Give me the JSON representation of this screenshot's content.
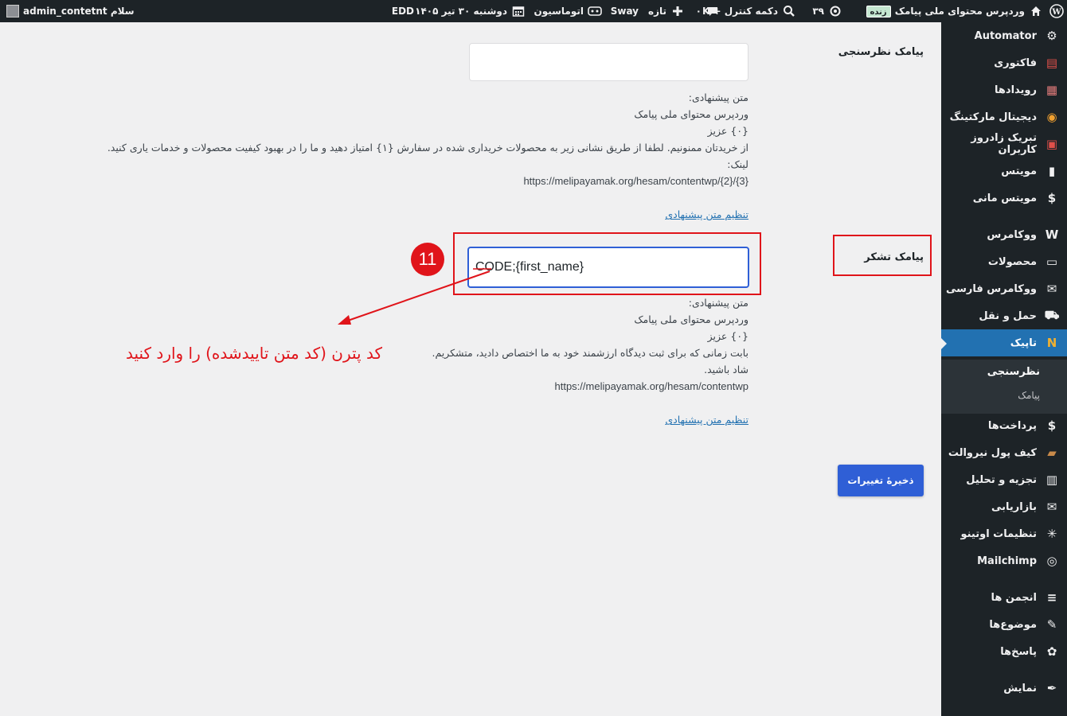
{
  "adminbar": {
    "greeting": "سلام admin_contetnt",
    "edd": "EDD",
    "date": "دوشنبه ۳۰ تیر ۱۴۰۵",
    "automation": "اتوماسیون",
    "sway": "Sway",
    "new": "تازه",
    "comments_count": "۰",
    "control_button": "دکمه کنترل + K",
    "updates_count": "۳۹",
    "live_badge": "زنده",
    "site_name": "وردپرس محتوای ملی پیامک"
  },
  "sidebar": {
    "items": [
      {
        "label": "Automator",
        "icon": "robot-icon"
      },
      {
        "label": "فاکتوری",
        "icon": "invoice-icon"
      },
      {
        "label": "رویدادها",
        "icon": "calendar-icon"
      },
      {
        "label": "دیجیتال مارکتینگ",
        "icon": "megaphone-circle-icon"
      },
      {
        "label": "تبریک زادروز کاربران",
        "icon": "birthday-icon"
      },
      {
        "label": "مویتس",
        "icon": "phone-icon"
      },
      {
        "label": "مویتس مانی",
        "icon": "dollar-icon"
      },
      {
        "label": "ووکامرس",
        "icon": "woocommerce-icon"
      },
      {
        "label": "محصولات",
        "icon": "products-icon"
      },
      {
        "label": "ووکامرس فارسی",
        "icon": "woo-persian-icon"
      },
      {
        "label": "حمل و نقل",
        "icon": "truck-icon"
      },
      {
        "label": "تاپیک",
        "icon": "topic-icon"
      },
      {
        "label": "پرداخت‌ها",
        "icon": "payments-icon"
      },
      {
        "label": "کیف پول نیروالت",
        "icon": "wallet-icon"
      },
      {
        "label": "تجزیه و تحلیل",
        "icon": "analytics-icon"
      },
      {
        "label": "بازاریابی",
        "icon": "marketing-icon"
      },
      {
        "label": "تنظیمات اوتینو",
        "icon": "settings-icon"
      },
      {
        "label": "Mailchimp",
        "icon": "mailchimp-icon"
      },
      {
        "label": "انجمن ها",
        "icon": "forums-icon"
      },
      {
        "label": "موضوع‌ها",
        "icon": "topics-icon"
      },
      {
        "label": "پاسخ‌ها",
        "icon": "replies-icon"
      },
      {
        "label": "نمایش",
        "icon": "appearance-icon"
      }
    ],
    "submenu": [
      "نظرسنجی",
      "پیامک"
    ]
  },
  "survey": {
    "label": "پیامک نظرسنجی",
    "value": "",
    "suggested_title": "متن پیشنهادی:",
    "line1": "وردپرس محتوای ملی پیامک",
    "line2": "{۰} عزیز",
    "line3": "از خریدتان ممنونیم. لطفا از طریق نشانی زیر به محصولات خریداری شده در سفارش {۱} امتیاز دهید و ما را در بهبود کیفیت محصولات و خدمات یاری کنید.",
    "line4": "لینک:",
    "url": "https://melipayamak.org/hesam/contentwp/{2}/{3}",
    "set_link": "تنظیم متن پیشنهادی"
  },
  "thanks": {
    "label": "پیامک تشکر",
    "value": "CODE;{first_name}",
    "suggested_title": "متن پیشنهادی:",
    "line1": "وردپرس محتوای ملی پیامک",
    "line2": "{۰} عزیز",
    "line3": "بابت زمانی که برای ثبت دیدگاه ارزشمند خود به ما اختصاص دادید، متشکریم.",
    "line4": "شاد باشید.",
    "url": "https://melipayamak.org/hesam/contentwp",
    "set_link": "تنظیم متن پیشنهادی"
  },
  "annotation": {
    "step": "11",
    "text": "کد پترن (کد متن تاییدشده) را وارد کنید"
  },
  "save_button": "ذخیرهٔ تغییرات",
  "colors": {
    "annotation_red": "#e0141a",
    "primary_blue": "#2f5fd6",
    "sidebar_bg": "#1d2327",
    "active_menu": "#2271b1"
  }
}
